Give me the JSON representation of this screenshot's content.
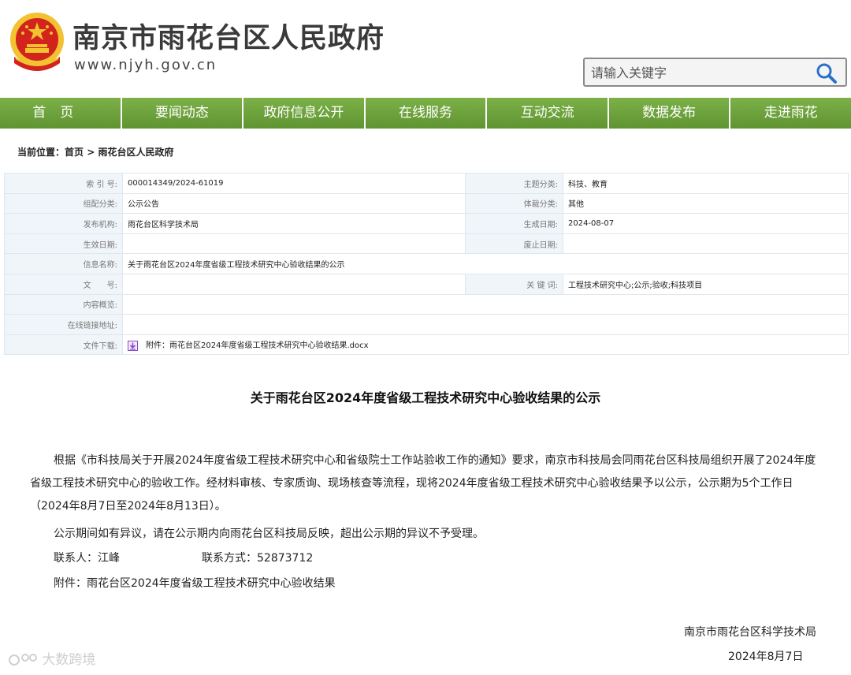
{
  "header": {
    "site_title": "南京市雨花台区人民政府",
    "site_url": "www.njyh.gov.cn",
    "search_placeholder": "请输入关键字"
  },
  "nav": [
    {
      "label": "首页"
    },
    {
      "label": "要闻动态"
    },
    {
      "label": "政府信息公开"
    },
    {
      "label": "在线服务"
    },
    {
      "label": "互动交流"
    },
    {
      "label": "数据发布"
    },
    {
      "label": "走进雨花"
    }
  ],
  "breadcrumb": {
    "prefix": "当前位置：",
    "home": "首页",
    "sep": " > ",
    "current": "雨花台区人民政府"
  },
  "meta": {
    "index_label": "索 引 号:",
    "index_value": "000014349/2024-61019",
    "topic_label": "主题分类:",
    "topic_value": "科技、教育",
    "org_category_label": "组配分类:",
    "org_category_value": "公示公告",
    "genre_label": "体裁分类:",
    "genre_value": "其他",
    "publisher_label": "发布机构:",
    "publisher_value": "雨花台区科学技术局",
    "created_label": "生成日期:",
    "created_value": "2024-08-07",
    "effective_label": "生效日期:",
    "effective_value": "",
    "abolish_label": "废止日期:",
    "abolish_value": "",
    "name_label": "信息名称:",
    "name_value": "关于雨花台区2024年度省级工程技术研究中心验收结果的公示",
    "docno_label": "文　　号:",
    "docno_value": "",
    "keywords_label": "关 键 词:",
    "keywords_value": "工程技术研究中心;公示;验收;科技项目",
    "summary_label": "内容概览:",
    "summary_value": "",
    "link_label": "在线链接地址:",
    "link_value": "",
    "download_label": "文件下载:",
    "download_value": "附件：雨花台区2024年度省级工程技术研究中心验收结果.docx"
  },
  "article": {
    "title": "关于雨花台区2024年度省级工程技术研究中心验收结果的公示",
    "paragraph1": "根据《市科技局关于开展2024年度省级工程技术研究中心和省级院士工作站验收工作的通知》要求，南京市科技局会同雨花台区科技局组织开展了2024年度省级工程技术研究中心的验收工作。经材料审核、专家质询、现场核查等流程，现将2024年度省级工程技术研究中心验收结果予以公示，公示期为5个工作日（2024年8月7日至2024年8月13日）。",
    "paragraph2": "公示期间如有异议，请在公示期内向雨花台区科技局反映，超出公示期的异议不予受理。",
    "contact_person": "联系人：江峰",
    "contact_phone": "联系方式：52873712",
    "attachment": "附件：雨花台区2024年度省级工程技术研究中心验收结果",
    "signature_org": "南京市雨花台区科学技术局",
    "signature_date": "2024年8月7日"
  },
  "watermark": "大数跨境",
  "colors": {
    "nav_green": "#6a9e3b",
    "label_bg": "#f0f5fa",
    "emblem_red": "#d2231d",
    "emblem_gold": "#f2c230"
  },
  "icons": {
    "emblem": "national-emblem-icon",
    "search": "search-icon",
    "download": "download-icon"
  }
}
